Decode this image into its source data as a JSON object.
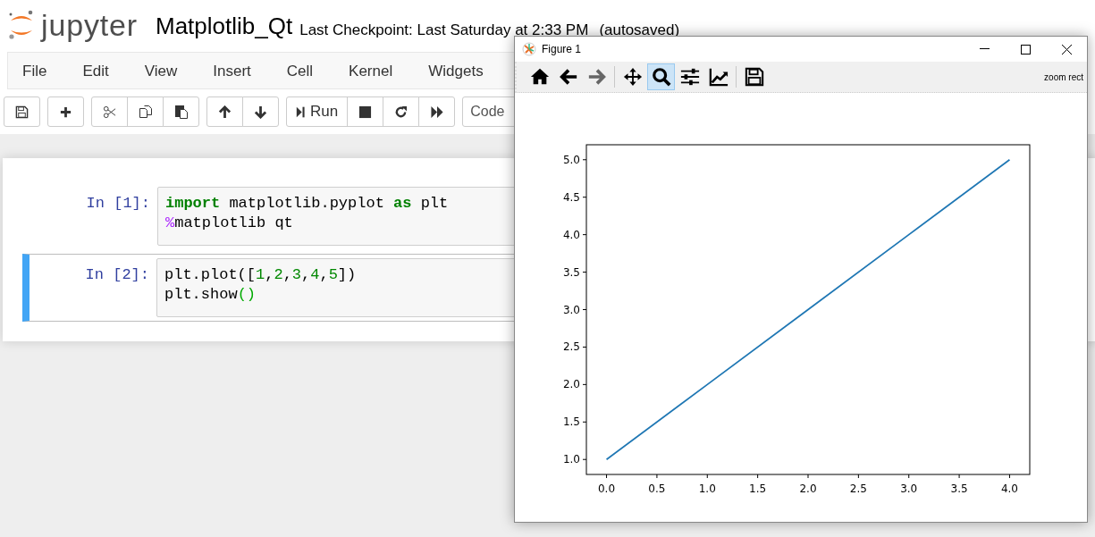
{
  "header": {
    "logo_text": "jupyter",
    "notebook_name": "Matplotlib_Qt",
    "checkpoint": "Last Checkpoint: Last Saturday at 2:33 PM",
    "autosave": "(autosaved)"
  },
  "menu": [
    "File",
    "Edit",
    "View",
    "Insert",
    "Cell",
    "Kernel",
    "Widgets"
  ],
  "toolbar": {
    "groups": [
      [
        {
          "kind": "save"
        }
      ],
      [
        {
          "kind": "add"
        }
      ],
      [
        {
          "kind": "cut"
        },
        {
          "kind": "copy"
        },
        {
          "kind": "paste"
        }
      ],
      [
        {
          "kind": "up"
        },
        {
          "kind": "down"
        }
      ],
      [
        {
          "kind": "run",
          "label": "Run"
        },
        {
          "kind": "stop"
        },
        {
          "kind": "restart"
        },
        {
          "kind": "fast-forward"
        }
      ]
    ],
    "cell_type": "Code"
  },
  "cells": [
    {
      "prompt": "In [1]:",
      "selected": false,
      "lines": [
        [
          {
            "kind": "keyword",
            "text": "import"
          },
          {
            "kind": "plain",
            "text": " matplotlib.pyplot "
          },
          {
            "kind": "keyword",
            "text": "as"
          },
          {
            "kind": "plain",
            "text": " plt"
          }
        ],
        [
          {
            "kind": "magic",
            "text": "%"
          },
          {
            "kind": "plain",
            "text": "matplotlib qt"
          }
        ]
      ]
    },
    {
      "prompt": "In [2]:",
      "selected": true,
      "lines": [
        [
          {
            "kind": "plain",
            "text": "plt.plot(["
          },
          {
            "kind": "number",
            "text": "1"
          },
          {
            "kind": "plain",
            "text": ","
          },
          {
            "kind": "number",
            "text": "2"
          },
          {
            "kind": "plain",
            "text": ","
          },
          {
            "kind": "number",
            "text": "3"
          },
          {
            "kind": "plain",
            "text": ","
          },
          {
            "kind": "number",
            "text": "4"
          },
          {
            "kind": "plain",
            "text": ","
          },
          {
            "kind": "number",
            "text": "5"
          },
          {
            "kind": "plain",
            "text": "])"
          }
        ],
        [
          {
            "kind": "plain",
            "text": "plt.show"
          },
          {
            "kind": "paren",
            "text": "()"
          }
        ]
      ]
    }
  ],
  "figure_window": {
    "title": "Figure 1",
    "tools": [
      {
        "kind": "home",
        "selected": false
      },
      {
        "kind": "back",
        "selected": false
      },
      {
        "kind": "forward",
        "selected": false
      },
      {
        "kind": "pan",
        "selected": false
      },
      {
        "kind": "zoom",
        "selected": true
      },
      {
        "kind": "configure",
        "selected": false
      },
      {
        "kind": "edit",
        "selected": false
      },
      {
        "kind": "save",
        "selected": false
      }
    ],
    "mode": "zoom rect",
    "chart_data": {
      "type": "line",
      "x": [
        0,
        1,
        2,
        3,
        4
      ],
      "series": [
        {
          "color": "#1f77b4",
          "values": [
            1,
            2,
            3,
            4,
            5
          ]
        }
      ],
      "xlim": [
        -0.2,
        4.2
      ],
      "ylim": [
        0.8,
        5.2
      ],
      "xticks": [
        {
          "value": 0,
          "label": "0.0"
        },
        {
          "value": 0.5,
          "label": "0.5"
        },
        {
          "value": 1,
          "label": "1.0"
        },
        {
          "value": 1.5,
          "label": "1.5"
        },
        {
          "value": 2,
          "label": "2.0"
        },
        {
          "value": 2.5,
          "label": "2.5"
        },
        {
          "value": 3,
          "label": "3.0"
        },
        {
          "value": 3.5,
          "label": "3.5"
        },
        {
          "value": 4,
          "label": "4.0"
        }
      ],
      "yticks": [
        {
          "value": 1,
          "label": "1.0"
        },
        {
          "value": 1.5,
          "label": "1.5"
        },
        {
          "value": 2,
          "label": "2.0"
        },
        {
          "value": 2.5,
          "label": "2.5"
        },
        {
          "value": 3,
          "label": "3.0"
        },
        {
          "value": 3.5,
          "label": "3.5"
        },
        {
          "value": 4,
          "label": "4.0"
        },
        {
          "value": 4.5,
          "label": "4.5"
        },
        {
          "value": 5,
          "label": "5.0"
        }
      ]
    }
  }
}
